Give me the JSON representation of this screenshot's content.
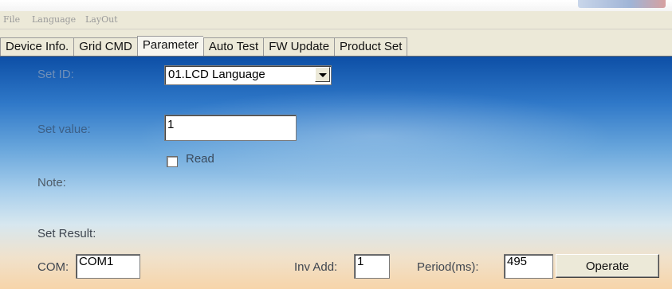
{
  "menu": {
    "file": "File",
    "language": "Language",
    "layout": "LayOut"
  },
  "tabs": [
    {
      "label": "Device Info."
    },
    {
      "label": "Grid CMD"
    },
    {
      "label": "Parameter"
    },
    {
      "label": "Auto Test"
    },
    {
      "label": "FW Update"
    },
    {
      "label": "Product Set"
    }
  ],
  "active_tab": "Parameter",
  "form": {
    "set_id_label": "Set ID:",
    "set_id_value": "01.LCD Language",
    "set_value_label": "Set value:",
    "set_value": "1",
    "read_label": "Read",
    "read_checked": false,
    "note_label": "Note:",
    "set_result_label": "Set Result:"
  },
  "footer": {
    "com_label": "COM:",
    "com_value": "COM1",
    "inv_add_label": "Inv Add:",
    "inv_add_value": "1",
    "period_label": "Period(ms):",
    "period_value": "495",
    "operate_label": "Operate"
  }
}
